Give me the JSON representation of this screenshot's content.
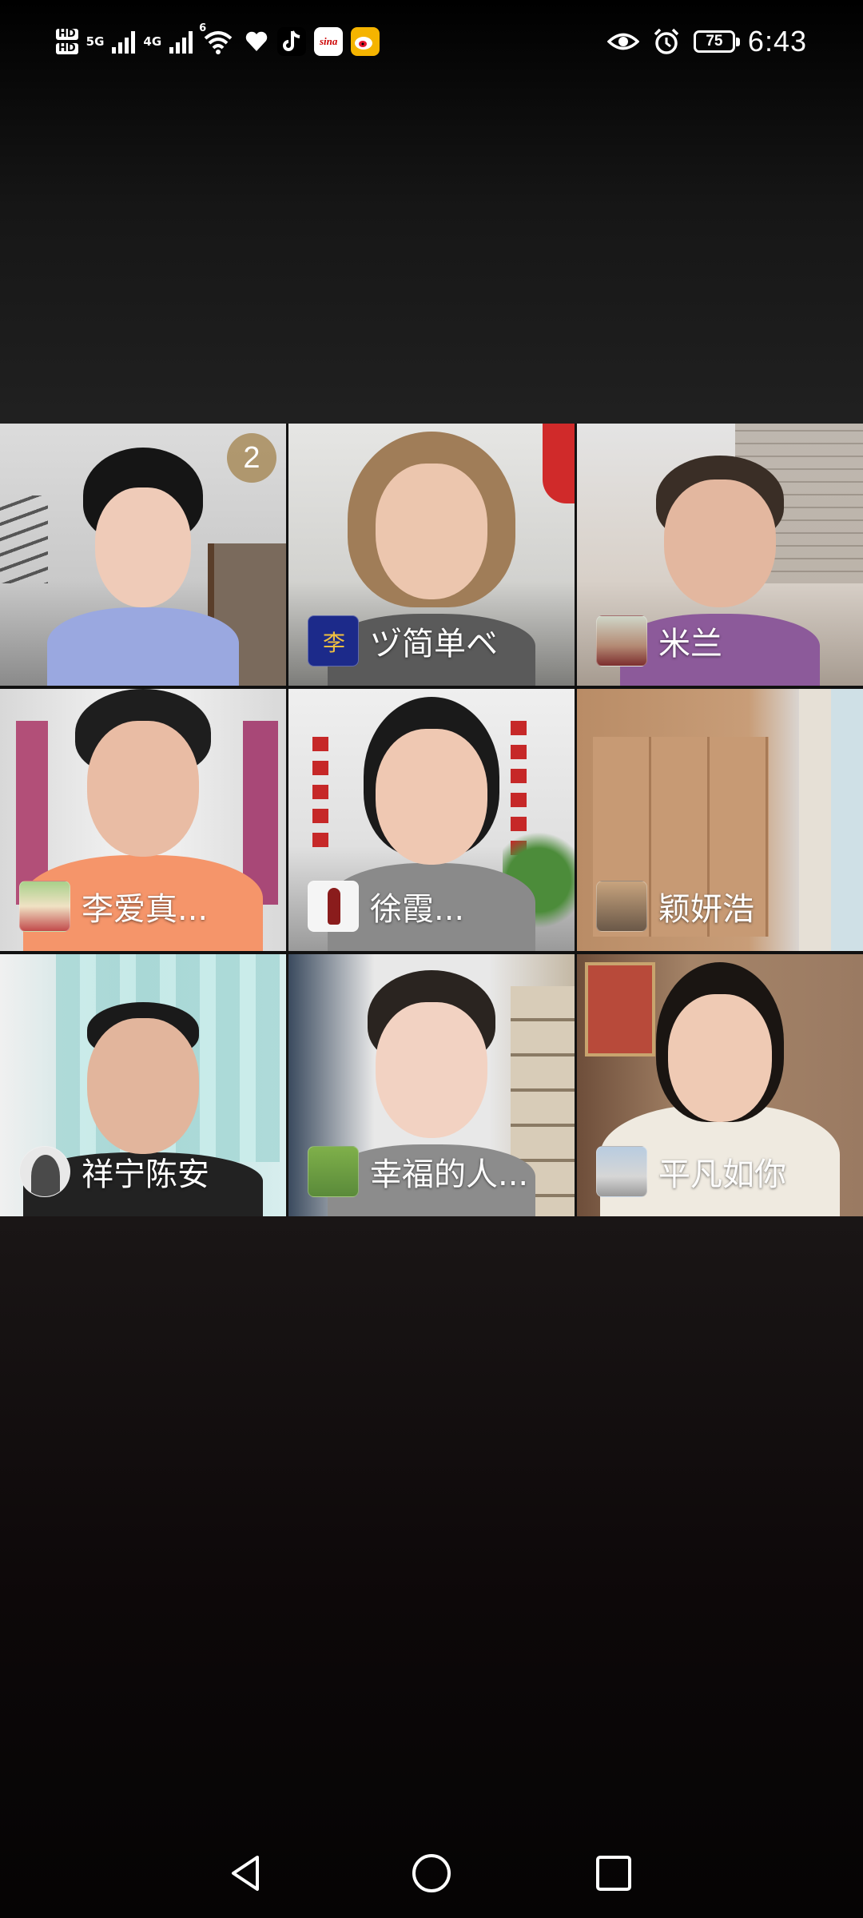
{
  "status_bar": {
    "left_labels": {
      "hd_top": "HD",
      "hd_bottom": "HD",
      "net1": "5G",
      "net2": "4G",
      "wifi_sub": "6"
    },
    "app_icons": [
      "tiktok-icon",
      "sina-icon",
      "weibo-icon"
    ],
    "battery_level": "75",
    "time": "6:43"
  },
  "participants": [
    {
      "name": "",
      "badge": "2"
    },
    {
      "name": "ヅ简单ベ"
    },
    {
      "name": "米兰"
    },
    {
      "name": "李爱真..."
    },
    {
      "name": "徐霞..."
    },
    {
      "name": "颖妍浩"
    },
    {
      "name": "祥宁陈安"
    },
    {
      "name": "幸福的人..."
    },
    {
      "name": "平凡如你"
    }
  ],
  "nav": {
    "back": "back-icon",
    "home": "home-icon",
    "recents": "recents-icon"
  },
  "colors": {
    "badge": "#a88c5c",
    "background_top": "#000000",
    "background_bottom": "#050404"
  }
}
